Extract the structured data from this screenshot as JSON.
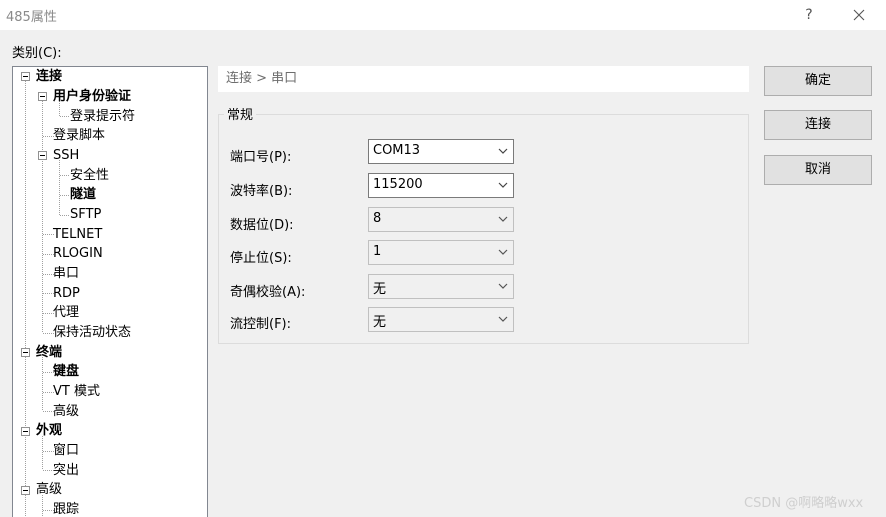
{
  "window": {
    "title": "485属性",
    "help_label": "?"
  },
  "category_label": "类别(C):",
  "tree": {
    "nodes": [
      {
        "label": "连接",
        "bold": true
      },
      {
        "label": "用户身份验证",
        "bold": true
      },
      {
        "label": "登录提示符",
        "bold": false
      },
      {
        "label": "登录脚本",
        "bold": false
      },
      {
        "label": "SSH",
        "bold": false
      },
      {
        "label": "安全性",
        "bold": false
      },
      {
        "label": "隧道",
        "bold": true
      },
      {
        "label": "SFTP",
        "bold": false
      },
      {
        "label": "TELNET",
        "bold": false
      },
      {
        "label": "RLOGIN",
        "bold": false
      },
      {
        "label": "串口",
        "bold": false
      },
      {
        "label": "RDP",
        "bold": false
      },
      {
        "label": "代理",
        "bold": false
      },
      {
        "label": "保持活动状态",
        "bold": false
      },
      {
        "label": "终端",
        "bold": true
      },
      {
        "label": "键盘",
        "bold": true
      },
      {
        "label": "VT 模式",
        "bold": false
      },
      {
        "label": "高级",
        "bold": false
      },
      {
        "label": "外观",
        "bold": true
      },
      {
        "label": "窗口",
        "bold": false
      },
      {
        "label": "突出",
        "bold": false
      },
      {
        "label": "高级",
        "bold": false
      },
      {
        "label": "跟踪",
        "bold": false
      }
    ]
  },
  "breadcrumb": "连接 > 串口",
  "group": {
    "title": "常规",
    "fields": [
      {
        "label": "端口号(P):",
        "value": "COM13",
        "enabled": true
      },
      {
        "label": "波特率(B):",
        "value": "115200",
        "enabled": true
      },
      {
        "label": "数据位(D):",
        "value": "8",
        "enabled": false
      },
      {
        "label": "停止位(S):",
        "value": "1",
        "enabled": false
      },
      {
        "label": "奇偶校验(A):",
        "value": "无",
        "enabled": false
      },
      {
        "label": "流控制(F):",
        "value": "无",
        "enabled": false
      }
    ]
  },
  "buttons": {
    "ok": "确定",
    "connect": "连接",
    "cancel": "取消"
  },
  "watermark": "CSDN @啊略略wxx"
}
